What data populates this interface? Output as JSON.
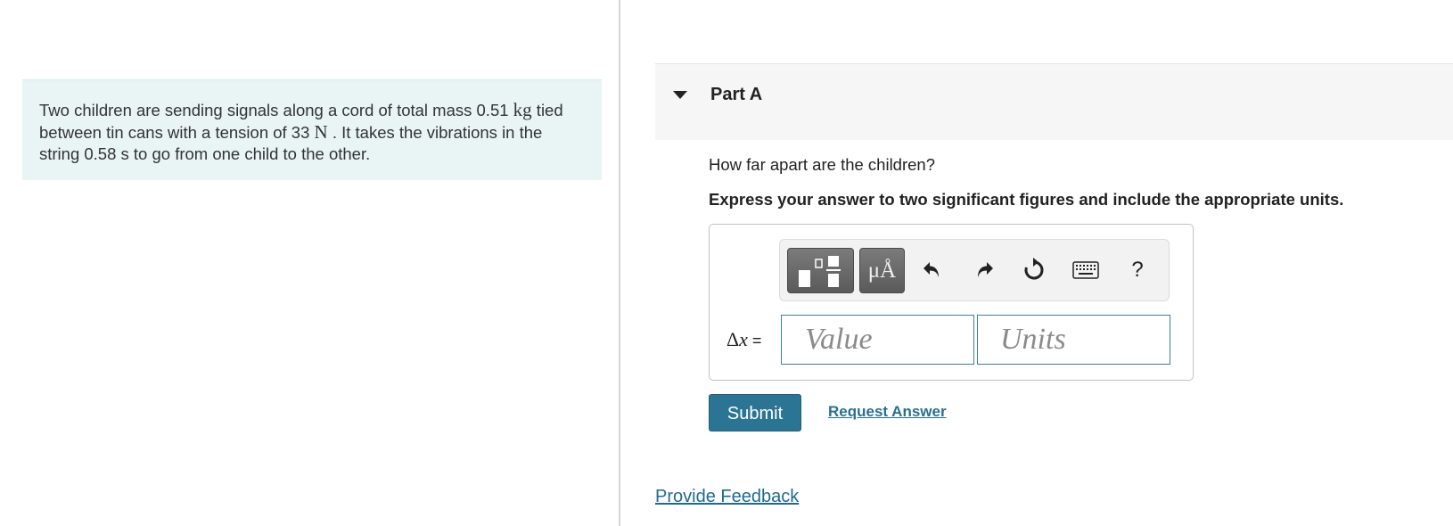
{
  "problem": {
    "line1_pre": "Two children are sending signals along a cord of total mass 0.51 ",
    "mass_unit": "kg",
    "line2_pre": " tied between tin cans with a tension of 33 ",
    "tension_unit": "N",
    "line2_post": " . It takes the vibrations in the string 0.58 s to go from one child to the other."
  },
  "part": {
    "title": "Part A"
  },
  "question": "How far apart are the children?",
  "instruction": "Express your answer to two significant figures and include the appropriate units.",
  "toolbar": {
    "units_label": "μÅ",
    "help_label": "?"
  },
  "answer": {
    "variable": "Δ",
    "variable_italic": "x",
    "equals": " =",
    "value_placeholder": "Value",
    "units_placeholder": "Units"
  },
  "buttons": {
    "submit": "Submit",
    "request_answer": "Request Answer"
  },
  "feedback_link": "Provide Feedback"
}
